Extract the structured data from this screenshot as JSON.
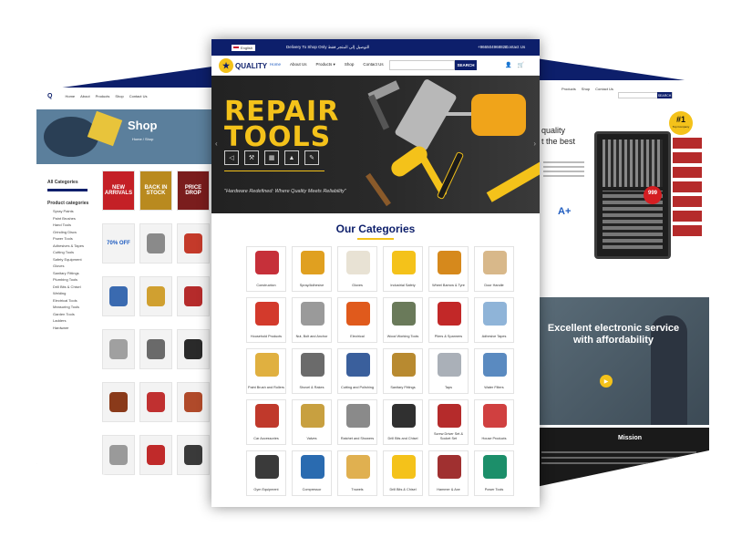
{
  "left_page": {
    "nav": [
      "Home",
      "About",
      "Products",
      "Shop",
      "Contact Us"
    ],
    "hero_title": "Shop",
    "breadcrumb": "Home / Shop",
    "sidebar": {
      "all_categories": "All Categories",
      "product_categories": "Product categories",
      "items": [
        "Spray Paints",
        "Paint Brushes",
        "Hand Tools",
        "Grinding Discs",
        "Power Tools",
        "Adhesives & Tapes",
        "Cutting Tools",
        "Safety Equipment",
        "Gloves",
        "Sanitary Fittings",
        "Plumbing Tools",
        "Drill Bits & Chisel",
        "Welding",
        "Electrical Tools",
        "Measuring Tools",
        "Garden Tools",
        "Ladders",
        "Hardware"
      ]
    },
    "promos": [
      "NEW ARRIVALS",
      "BACK IN STOCK",
      "PRICE DROP",
      "70% OFF"
    ]
  },
  "right_page": {
    "nav": [
      "Products",
      "Shop",
      "Contact Us"
    ],
    "search_button": "SEARCH",
    "hero_line1": "quality",
    "hero_line2": "t the best",
    "badge_main": "#1",
    "badge_sub": "Top Company",
    "sale_badge": "999",
    "grade": "A+",
    "banner_title": "Excellent electronic service with affordability",
    "mission_title": "Mission"
  },
  "center_page": {
    "topbar": {
      "language": "English",
      "delivery": "Delivery To Shop Only التوصيل إلى المتجر فقط",
      "phone": "+966504968822",
      "contact": "Contact Us"
    },
    "logo": "QUALITY",
    "menu": [
      "Home",
      "About Us",
      "Products ▾",
      "Shop",
      "Contact Us"
    ],
    "search_placeholder": "",
    "search_button": "SEARCH",
    "hero": {
      "line1": "REPAIR",
      "line2": "TOOLS",
      "tagline": "\"Hardware Redefined: Where Quality Meets Reliability\""
    },
    "categories_title": "Our Categories",
    "categories": [
      {
        "name": "Construction",
        "color": "#c6303a"
      },
      {
        "name": "Spray/Adhesive",
        "color": "#e0a020"
      },
      {
        "name": "Gloves",
        "color": "#e8e2d4"
      },
      {
        "name": "Industrial Safety",
        "color": "#f4c21a"
      },
      {
        "name": "Wheel Barrow & Tyre",
        "color": "#d6891c"
      },
      {
        "name": "Door Handle",
        "color": "#d8b88a"
      },
      {
        "name": "Household Products",
        "color": "#d33a2c"
      },
      {
        "name": "Nut, Bolt and Anchor",
        "color": "#9a9a9a"
      },
      {
        "name": "Electrical",
        "color": "#e05a1c"
      },
      {
        "name": "Wood Working Tools",
        "color": "#6a7a5a"
      },
      {
        "name": "Pliers & Spanners",
        "color": "#c22828"
      },
      {
        "name": "Adhesive Tapes",
        "color": "#8fb4d8"
      },
      {
        "name": "Paint Brush and Rollers",
        "color": "#e0b040"
      },
      {
        "name": "Shovel & Rakes",
        "color": "#6b6b6b"
      },
      {
        "name": "Cutting and Polishing",
        "color": "#3a5f9c"
      },
      {
        "name": "Sanitary Fittings",
        "color": "#b88a30"
      },
      {
        "name": "Taps",
        "color": "#aab0b8"
      },
      {
        "name": "Water Filters",
        "color": "#5a8ac0"
      },
      {
        "name": "Car Accessories",
        "color": "#c0392b"
      },
      {
        "name": "Valves",
        "color": "#c8a040"
      },
      {
        "name": "Ratchet and Showers",
        "color": "#8a8a8a"
      },
      {
        "name": "Drill Bits and Chisel",
        "color": "#303030"
      },
      {
        "name": "Screw Driver Set & Socket Set",
        "color": "#b52b2b"
      },
      {
        "name": "House Products",
        "color": "#d04040"
      },
      {
        "name": "Gym Equipment",
        "color": "#3a3a3a"
      },
      {
        "name": "Compressor",
        "color": "#2a6bb0"
      },
      {
        "name": "Trowels",
        "color": "#e0b050"
      },
      {
        "name": "Drill Bits & Chisel",
        "color": "#f4c21a"
      },
      {
        "name": "Hammer & Axe",
        "color": "#a03030"
      },
      {
        "name": "Power Tools",
        "color": "#1c8f6a"
      }
    ]
  }
}
